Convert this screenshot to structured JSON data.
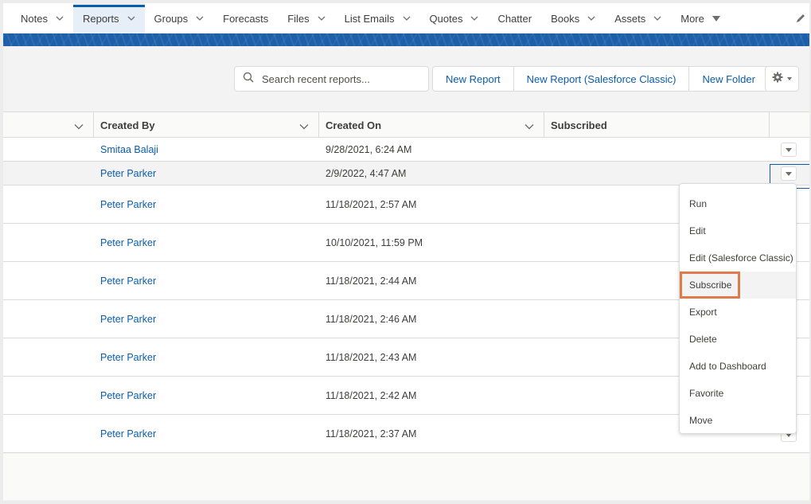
{
  "nav": {
    "items": [
      {
        "label": "Notes",
        "has_menu": true,
        "active": false
      },
      {
        "label": "Reports",
        "has_menu": true,
        "active": true
      },
      {
        "label": "Groups",
        "has_menu": true,
        "active": false
      },
      {
        "label": "Forecasts",
        "has_menu": false,
        "active": false
      },
      {
        "label": "Files",
        "has_menu": true,
        "active": false
      },
      {
        "label": "List Emails",
        "has_menu": true,
        "active": false
      },
      {
        "label": "Quotes",
        "has_menu": true,
        "active": false
      },
      {
        "label": "Chatter",
        "has_menu": false,
        "active": false
      },
      {
        "label": "Books",
        "has_menu": true,
        "active": false
      },
      {
        "label": "Assets",
        "has_menu": true,
        "active": false
      }
    ],
    "more_label": "More",
    "edit_icon": "pencil-icon"
  },
  "toolbar": {
    "search_placeholder": "Search recent reports...",
    "search_value": "",
    "new_report_label": "New Report",
    "new_report_classic_label": "New Report (Salesforce Classic)",
    "new_folder_label": "New Folder",
    "settings_icon": "gear-icon"
  },
  "table": {
    "columns": [
      "",
      "Created By",
      "Created On",
      "Subscribed"
    ],
    "rows": [
      {
        "created_by": "Smitaa Balaji",
        "created_on": "9/28/2021, 6:24 AM",
        "subscribed": ""
      },
      {
        "created_by": "Peter Parker",
        "created_on": "2/9/2022, 4:47 AM",
        "subscribed": ""
      },
      {
        "created_by": "Peter Parker",
        "created_on": "11/18/2021, 2:57 AM",
        "subscribed": ""
      },
      {
        "created_by": "Peter Parker",
        "created_on": "10/10/2021, 11:59 PM",
        "subscribed": ""
      },
      {
        "created_by": "Peter Parker",
        "created_on": "11/18/2021, 2:44 AM",
        "subscribed": ""
      },
      {
        "created_by": "Peter Parker",
        "created_on": "11/18/2021, 2:46 AM",
        "subscribed": ""
      },
      {
        "created_by": "Peter Parker",
        "created_on": "11/18/2021, 2:43 AM",
        "subscribed": ""
      },
      {
        "created_by": "Peter Parker",
        "created_on": "11/18/2021, 2:42 AM",
        "subscribed": ""
      },
      {
        "created_by": "Peter Parker",
        "created_on": "11/18/2021, 2:37 AM",
        "subscribed": ""
      }
    ]
  },
  "row_menu": {
    "items": [
      "Run",
      "Edit",
      "Edit (Salesforce Classic)",
      "Subscribe",
      "Export",
      "Delete",
      "Add to Dashboard",
      "Favorite",
      "Move"
    ],
    "highlighted": "Subscribe"
  },
  "colors": {
    "accent": "#0b5cab",
    "banner": "#1d5fa8",
    "highlight_outline": "#e07a4b"
  }
}
